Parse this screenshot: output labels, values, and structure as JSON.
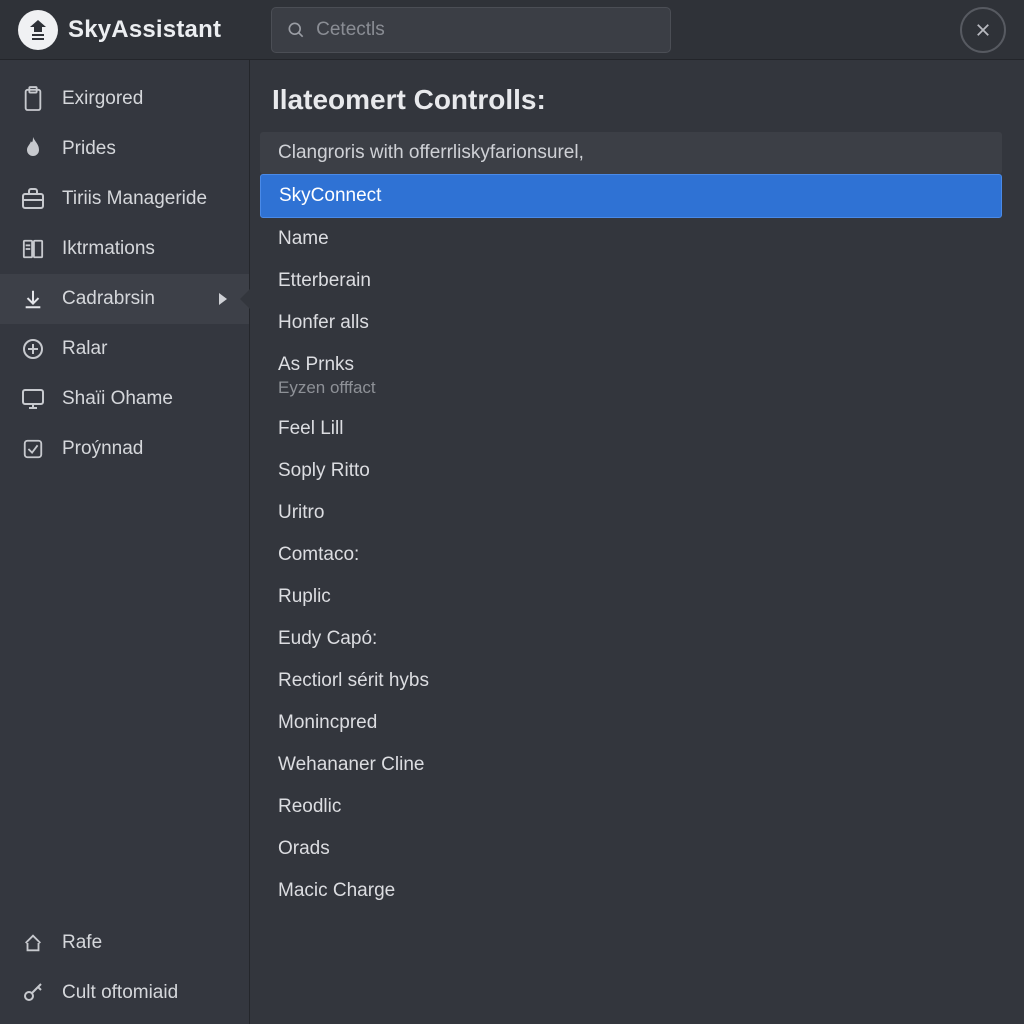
{
  "app": {
    "title": "SkyAssistant"
  },
  "search": {
    "placeholder": "Cetectls"
  },
  "sidebar": {
    "items": [
      {
        "label": "Exirgored"
      },
      {
        "label": "Prides"
      },
      {
        "label": "Tiriis Manageride"
      },
      {
        "label": "Iktrmations"
      },
      {
        "label": "Cadrabrsin"
      },
      {
        "label": "Ralar"
      },
      {
        "label": "Shaïi Ohame"
      },
      {
        "label": "Proýnnad"
      }
    ],
    "bottom": [
      {
        "label": "Rafe"
      },
      {
        "label": "Cult oftomiaid"
      }
    ]
  },
  "main": {
    "title": "Ilateomert Controlls:",
    "groupHeader": "Clangroris with offerrliskyfarionsurel,",
    "items": [
      {
        "label": "SkyConnect"
      },
      {
        "label": "Name"
      },
      {
        "label": "Etterberain"
      },
      {
        "label": "Honfer alls"
      },
      {
        "label": "As Prnks",
        "sub": "Eyzen offfact"
      },
      {
        "label": "Feel Lill"
      },
      {
        "label": "Soply Ritto"
      },
      {
        "label": "Uritro"
      },
      {
        "label": "Comtaco:"
      },
      {
        "label": "Ruplic"
      },
      {
        "label": "Eudy Capó:"
      },
      {
        "label": "Rectiorl sérit hybs"
      },
      {
        "label": "Monincpred"
      },
      {
        "label": "Wehananer Cline"
      },
      {
        "label": "Reodlic"
      },
      {
        "label": "Orads"
      },
      {
        "label": "Macic Charge"
      }
    ]
  }
}
